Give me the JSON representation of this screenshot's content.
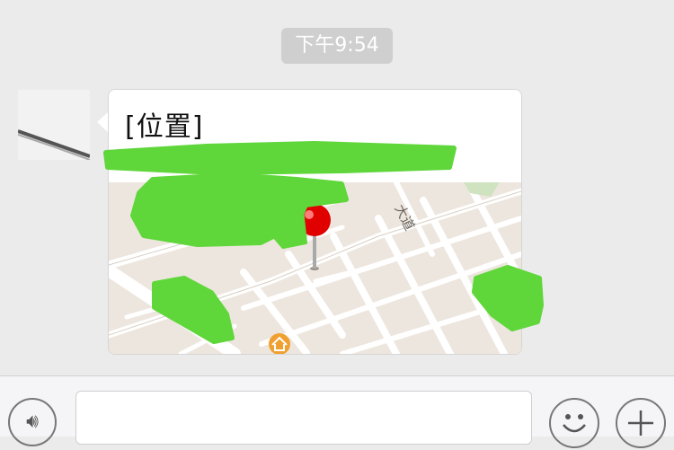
{
  "chat": {
    "timestamp": "下午9:54",
    "message": {
      "title": "[位置]",
      "type": "location"
    }
  },
  "map": {
    "road_label": "大道"
  },
  "input_bar": {
    "text_value": "",
    "voice_icon": "voice-icon",
    "emoji_icon": "emoji-icon",
    "plus_icon": "plus-icon"
  },
  "colors": {
    "background": "#ebebeb",
    "bubble": "#ffffff",
    "map_land": "#ede6de",
    "road": "#ffffff",
    "pin": "#e00000",
    "redaction": "#5fd63a",
    "poi": "#f0a030"
  }
}
